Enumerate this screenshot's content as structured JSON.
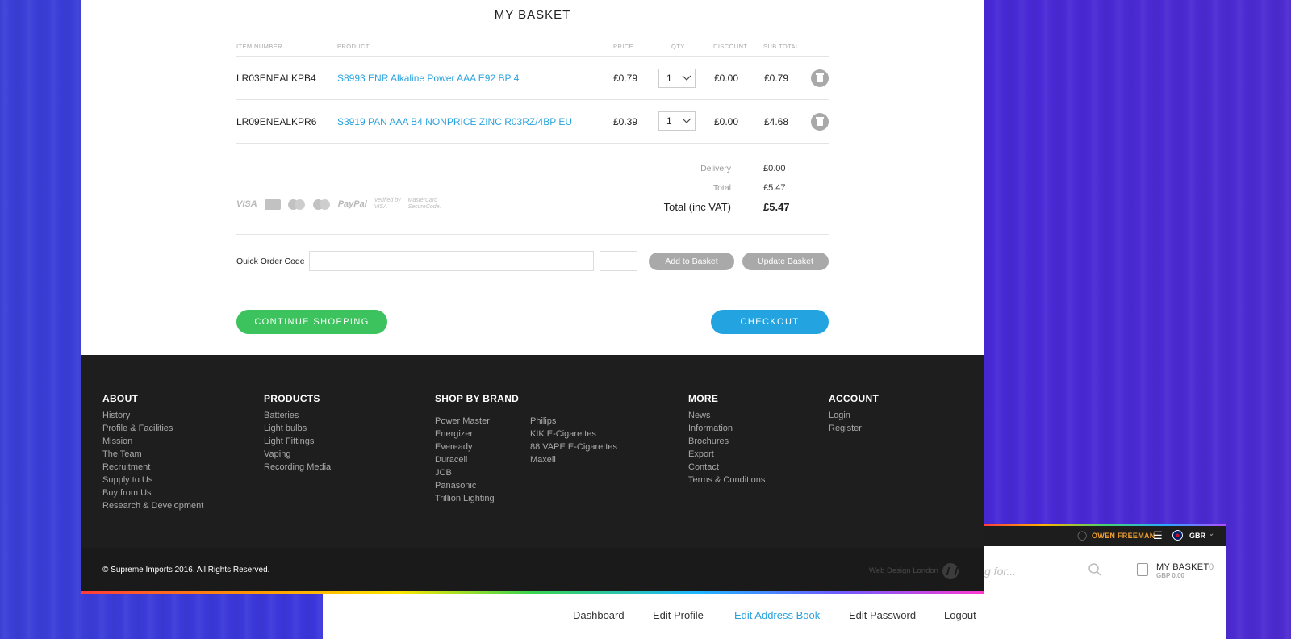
{
  "colors": {
    "accent_blue": "#2aa3dd",
    "continue_green": "#3cc35d",
    "checkout_blue": "#23a4e0",
    "user_orange": "#f0a030"
  },
  "basket": {
    "title": "MY BASKET",
    "columns": {
      "item_number": "ITEM NUMBER",
      "product": "PRODUCT",
      "price": "PRICE",
      "qty": "QTY",
      "discount": "DISCOUNT",
      "subtotal": "SUB TOTAL"
    },
    "rows": [
      {
        "item_number": "LR03ENEALKPB4",
        "product": "S8993 ENR Alkaline Power AAA E92 BP 4",
        "price": "£0.79",
        "qty": "1",
        "discount": "£0.00",
        "subtotal": "£0.79"
      },
      {
        "item_number": "LR09ENEALKPR6",
        "product": "S3919 PAN AAA B4 NONPRICE ZINC R03RZ/4BP EU",
        "price": "£0.39",
        "qty": "1",
        "discount": "£0.00",
        "subtotal": "£4.68"
      }
    ],
    "summary": {
      "delivery_label": "Delivery",
      "delivery": "£0.00",
      "total_label": "Total",
      "total": "£5.47",
      "total_vat_label": "Total (inc VAT)",
      "total_vat": "£5.47"
    },
    "payment_logos": {
      "visa": "VISA",
      "paypal": "PayPal",
      "verified_visa_1": "Verified by",
      "verified_visa_2": "VISA",
      "mc_secure_1": "MasterCard",
      "mc_secure_2": "SecureCode."
    },
    "quick_order": {
      "label": "Quick Order Code",
      "code_value": "",
      "qty_value": "",
      "add_label": "Add to Basket",
      "update_label": "Update Basket"
    },
    "continue_label": "CONTINUE SHOPPING",
    "checkout_label": "CHECKOUT"
  },
  "footer": {
    "about": {
      "heading": "ABOUT",
      "links": [
        "History",
        "Profile & Facilities",
        "Mission",
        "The Team",
        "Recruitment",
        "Supply to Us",
        "Buy from Us",
        "Research & Development"
      ]
    },
    "products": {
      "heading": "PRODUCTS",
      "links": [
        "Batteries",
        "Light bulbs",
        "Light Fittings",
        "Vaping",
        "Recording Media"
      ]
    },
    "brands": {
      "heading": "SHOP BY BRAND",
      "col1": [
        "Power Master",
        "Energizer",
        "Eveready",
        "Duracell",
        "JCB",
        "Panasonic",
        "Trillion Lighting"
      ],
      "col2": [
        "Philips",
        "KIK E-Cigarettes",
        "88 VAPE E-Cigarettes",
        "Maxell"
      ]
    },
    "more": {
      "heading": "MORE",
      "links": [
        "News",
        "Information",
        "Brochures",
        "Export",
        "Contact",
        "Terms & Conditions"
      ]
    },
    "account": {
      "heading": "ACCOUNT",
      "links": [
        "Login",
        "Register"
      ]
    },
    "copyright": "© Supreme Imports 2016. All Rights Reserved.",
    "credit": "Web Design London"
  },
  "secondary_screen": {
    "user_name": "OWEN FREEMAN",
    "country": "GBR",
    "search_placeholder": "g for...",
    "basket_label": "MY BASKET",
    "basket_count": "0",
    "basket_total": "GBP 0,00",
    "nav": [
      "Dashboard",
      "Edit Profile",
      "Edit Address Book",
      "Edit Password",
      "Logout"
    ],
    "active_nav": "Edit Address Book"
  }
}
